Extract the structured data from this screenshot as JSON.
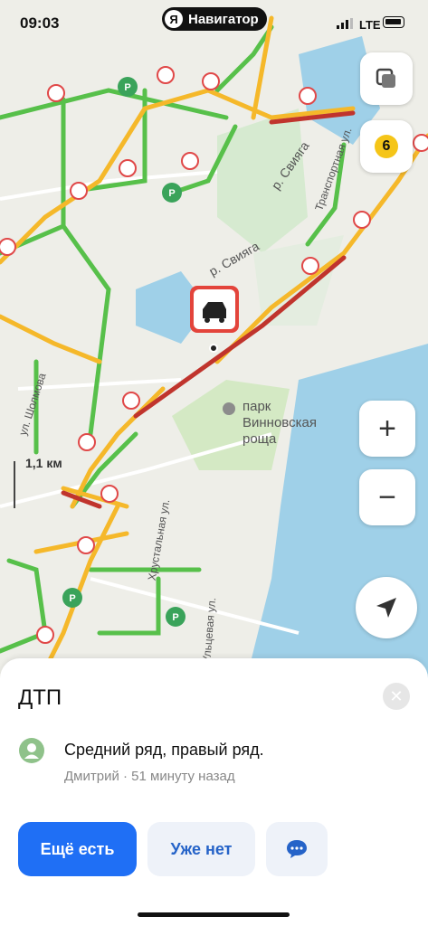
{
  "status_bar": {
    "time": "09:03",
    "network": "LTE"
  },
  "app": {
    "logo_letter": "Я",
    "name": "Навигатор"
  },
  "map": {
    "labels": {
      "river": "р. Свияга",
      "river2": "р. Свияга",
      "street_transport": "Транспортная ул.",
      "street_sholmova": "ул. Шолмова",
      "street_crystal": "Хрустальная ул.",
      "street_other": "Ульцевая ул.",
      "park": "парк Винновская роща"
    },
    "scale": "1,1 км",
    "speed_limit": "6",
    "incident_marker": "dtp-car-icon"
  },
  "sheet": {
    "title": "ДТП",
    "comment": "Средний ряд, правый ряд.",
    "meta": "Дмитрий · 51 минуту назад",
    "buttons": {
      "still_there": "Ещё есть",
      "gone": "Уже нет"
    }
  },
  "colors": {
    "accent": "#1f6ff5",
    "traffic_green": "#57c04a",
    "traffic_yellow": "#f5b82a",
    "traffic_red": "#c0342d",
    "water": "#9fd0e8",
    "park": "#d4e9c4"
  }
}
